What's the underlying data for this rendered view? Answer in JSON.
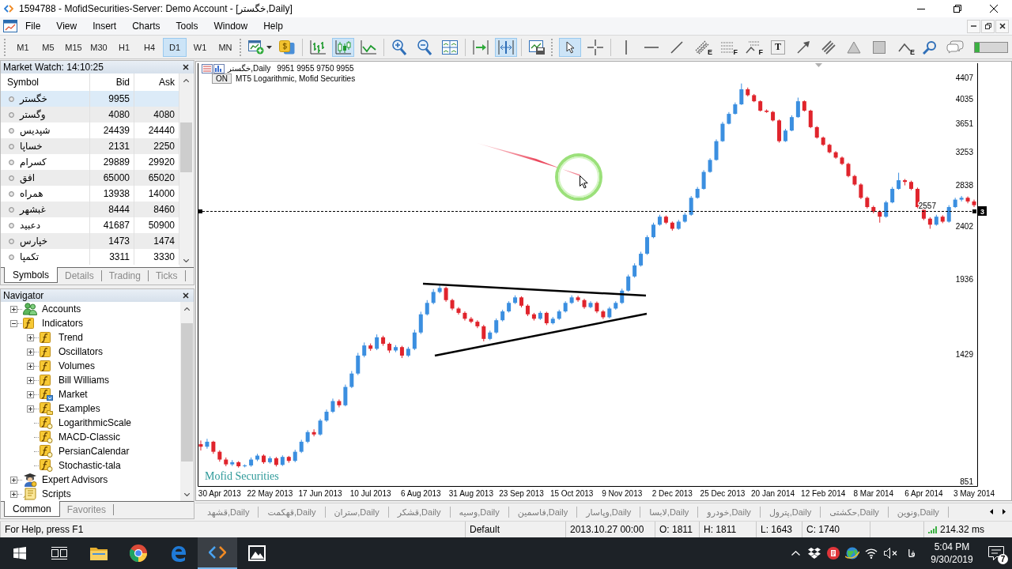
{
  "window": {
    "title": "1594788 - MofidSecurities-Server: Demo Account - [خگستر,Daily]"
  },
  "menu": [
    "File",
    "View",
    "Insert",
    "Charts",
    "Tools",
    "Window",
    "Help"
  ],
  "toolbar": {
    "timeframes": [
      {
        "label": "M1",
        "selected": false
      },
      {
        "label": "M5",
        "selected": false
      },
      {
        "label": "M15",
        "selected": false
      },
      {
        "label": "M30",
        "selected": false
      },
      {
        "label": "H1",
        "selected": false
      },
      {
        "label": "H4",
        "selected": false
      },
      {
        "label": "D1",
        "selected": true
      },
      {
        "label": "W1",
        "selected": false
      },
      {
        "label": "MN",
        "selected": false
      }
    ],
    "bands": [
      [
        [
          {
            "kind": "new-chart",
            "selected": false,
            "dropdown": true
          },
          {
            "kind": "trade",
            "selected": false
          }
        ],
        [
          {
            "kind": "bar-chart",
            "selected": false
          },
          {
            "kind": "candles",
            "selected": true
          },
          {
            "kind": "line-chart",
            "selected": false
          }
        ],
        [
          {
            "kind": "zoom-in",
            "selected": false
          },
          {
            "kind": "zoom-out",
            "selected": false
          },
          {
            "kind": "tile",
            "selected": false
          }
        ],
        [
          {
            "kind": "chart-shift",
            "selected": false
          },
          {
            "kind": "autoscroll",
            "selected": true
          }
        ],
        [
          {
            "kind": "templates",
            "selected": false
          }
        ]
      ],
      [
        [
          {
            "kind": "cursor",
            "selected": true
          },
          {
            "kind": "crosshair",
            "selected": false
          }
        ],
        [
          {
            "kind": "vline",
            "selected": false
          },
          {
            "kind": "hline",
            "selected": false
          },
          {
            "kind": "trendline",
            "selected": false
          },
          {
            "kind": "channel",
            "selected": false,
            "badge": "E"
          },
          {
            "kind": "fibo",
            "selected": false,
            "badge": "F"
          },
          {
            "kind": "fibo-fan",
            "selected": false,
            "badge": "F"
          },
          {
            "kind": "text",
            "selected": false,
            "badge": "T"
          },
          {
            "kind": "arrow",
            "selected": false
          },
          {
            "kind": "parallel",
            "selected": false
          },
          {
            "kind": "triangle",
            "selected": false
          },
          {
            "kind": "rectangle",
            "selected": false
          },
          {
            "kind": "polyline",
            "selected": false,
            "badge": "E"
          },
          {
            "kind": "search",
            "selected": false
          },
          {
            "kind": "chat",
            "selected": false
          }
        ]
      ]
    ],
    "meter": {
      "level": 0.15
    }
  },
  "market_watch": {
    "title": "Market Watch: 14:10:25",
    "columns": [
      "Symbol",
      "Bid",
      "Ask"
    ],
    "rows": [
      {
        "symbol": "خگستر",
        "bid": "9955",
        "selected": true
      },
      {
        "symbol": "وگستر",
        "bid": "4080",
        "ask": "4080",
        "selected": false
      },
      {
        "symbol": "شپدیس",
        "bid": "24439",
        "ask": "24440",
        "selected": false
      },
      {
        "symbol": "خساپا",
        "bid": "2131",
        "ask": "2250",
        "selected": false
      },
      {
        "symbol": "کسرام",
        "bid": "29889",
        "ask": "29920",
        "selected": false
      },
      {
        "symbol": "افق",
        "bid": "65000",
        "ask": "65020",
        "selected": false
      },
      {
        "symbol": "همراه",
        "bid": "13938",
        "ask": "14000",
        "selected": false
      },
      {
        "symbol": "غبشهر",
        "bid": "8444",
        "ask": "8460",
        "selected": false
      },
      {
        "symbol": "دعبید",
        "bid": "41687",
        "ask": "50900",
        "selected": false
      },
      {
        "symbol": "خپارس",
        "bid": "1473",
        "ask": "1474",
        "selected": false
      },
      {
        "symbol": "تکمپا",
        "bid": "3311",
        "ask": "3330",
        "selected": false
      }
    ],
    "tabs": [
      {
        "label": "Symbols",
        "selected": true
      },
      {
        "label": "Details",
        "selected": false
      },
      {
        "label": "Trading",
        "selected": false
      },
      {
        "label": "Ticks",
        "selected": false
      }
    ]
  },
  "navigator": {
    "title": "Navigator",
    "tree": [
      {
        "label": "Accounts",
        "kind": "accounts",
        "expanded": false
      },
      {
        "label": "Indicators",
        "kind": "indicator-folder",
        "expanded": true,
        "children": [
          {
            "label": "Trend",
            "kind": "indicator-folder",
            "expanded": false
          },
          {
            "label": "Oscillators",
            "kind": "indicator-folder",
            "expanded": false
          },
          {
            "label": "Volumes",
            "kind": "indicator-folder",
            "expanded": false
          },
          {
            "label": "Bill Williams",
            "kind": "indicator-folder",
            "expanded": false
          },
          {
            "label": "Market",
            "kind": "market-folder",
            "expanded": false
          },
          {
            "label": "Examples",
            "kind": "examples-folder",
            "expanded": false
          },
          {
            "label": "LogarithmicScale",
            "kind": "indicator"
          },
          {
            "label": "MACD-Classic",
            "kind": "indicator"
          },
          {
            "label": "PersianCalendar",
            "kind": "indicator"
          },
          {
            "label": "Stochastic-tala",
            "kind": "indicator"
          }
        ]
      },
      {
        "label": "Expert Advisors",
        "kind": "experts",
        "expanded": false
      },
      {
        "label": "Scripts",
        "kind": "scripts",
        "expanded": false
      }
    ],
    "tabs": [
      {
        "label": "Common",
        "selected": true
      },
      {
        "label": "Favorites",
        "selected": false
      }
    ]
  },
  "chart": {
    "symbol": "خگستر,Daily",
    "prices": "9951 9955 9750 9955",
    "indicator_toggle": "ON",
    "indicator": "MT5 Logarithmic, Mofid Securities",
    "brand_text": "Mofid Securities",
    "price_tag": "3",
    "chart_data": {
      "type": "candlestick",
      "log": true,
      "ylim": [
        835,
        4670
      ],
      "yticks": [
        851,
        1429,
        1936,
        2402,
        2838,
        3253,
        3651,
        4035,
        4407
      ],
      "categories": [
        null,
        null,
        null,
        "30 Apr 2013",
        null,
        null,
        null,
        null,
        null,
        null,
        null,
        "22 May 2013",
        null,
        null,
        null,
        null,
        null,
        null,
        null,
        "17 Jun 2013",
        null,
        null,
        null,
        null,
        null,
        null,
        null,
        "10 Jul 2013",
        null,
        null,
        null,
        null,
        null,
        null,
        null,
        "6 Aug 2013",
        null,
        null,
        null,
        null,
        null,
        null,
        null,
        "31 Aug 2013",
        null,
        null,
        null,
        null,
        null,
        null,
        null,
        "23 Sep 2013",
        null,
        null,
        null,
        null,
        null,
        null,
        null,
        "15 Oct 2013",
        null,
        null,
        null,
        null,
        null,
        null,
        null,
        "9 Nov 2013",
        null,
        null,
        null,
        null,
        null,
        null,
        null,
        "2 Dec 2013",
        null,
        null,
        null,
        null,
        null,
        null,
        null,
        "25 Dec 2013",
        null,
        null,
        null,
        null,
        null,
        null,
        null,
        "20 Jan 2014",
        null,
        null,
        null,
        null,
        null,
        null,
        null,
        "12 Feb 2014",
        null,
        null,
        null,
        null,
        null,
        null,
        null,
        "8 Mar 2014",
        null,
        null,
        null,
        null,
        null,
        null,
        null,
        "6 Apr 2014",
        null,
        null,
        null,
        null,
        null,
        null,
        null,
        "3 May 2014"
      ],
      "ohlc": [
        [
          990,
          1005,
          965,
          980
        ],
        [
          980,
          1012,
          972,
          1000
        ],
        [
          1000,
          1004,
          952,
          960
        ],
        [
          960,
          966,
          922,
          930
        ],
        [
          930,
          938,
          905,
          912
        ],
        [
          912,
          928,
          906,
          920
        ],
        [
          920,
          924,
          900,
          905
        ],
        [
          905,
          912,
          901,
          908
        ],
        [
          908,
          938,
          903,
          930
        ],
        [
          930,
          952,
          924,
          945
        ],
        [
          945,
          950,
          914,
          920
        ],
        [
          920,
          942,
          915,
          935
        ],
        [
          935,
          940,
          904,
          910
        ],
        [
          910,
          946,
          906,
          940
        ],
        [
          940,
          944,
          918,
          925
        ],
        [
          925,
          968,
          920,
          960
        ],
        [
          960,
          1008,
          955,
          1000
        ],
        [
          1000,
          1048,
          994,
          1040
        ],
        [
          1040,
          1052,
          1022,
          1030
        ],
        [
          1030,
          1098,
          1025,
          1090
        ],
        [
          1090,
          1140,
          1084,
          1130
        ],
        [
          1130,
          1192,
          1124,
          1180
        ],
        [
          1180,
          1188,
          1150,
          1160
        ],
        [
          1160,
          1262,
          1155,
          1250
        ],
        [
          1250,
          1334,
          1244,
          1320
        ],
        [
          1320,
          1436,
          1312,
          1420
        ],
        [
          1420,
          1498,
          1410,
          1480
        ],
        [
          1480,
          1492,
          1448,
          1460
        ],
        [
          1460,
          1548,
          1452,
          1530
        ],
        [
          1530,
          1540,
          1478,
          1490
        ],
        [
          1490,
          1498,
          1436,
          1450
        ],
        [
          1450,
          1482,
          1440,
          1470
        ],
        [
          1470,
          1478,
          1406,
          1420
        ],
        [
          1420,
          1472,
          1412,
          1460
        ],
        [
          1460,
          1578,
          1452,
          1560
        ],
        [
          1560,
          1698,
          1550,
          1680
        ],
        [
          1680,
          1780,
          1672,
          1760
        ],
        [
          1760,
          1862,
          1750,
          1840
        ],
        [
          1840,
          1895,
          1830,
          1870
        ],
        [
          1870,
          1880,
          1768,
          1780
        ],
        [
          1780,
          1790,
          1708,
          1720
        ],
        [
          1720,
          1730,
          1678,
          1690
        ],
        [
          1690,
          1700,
          1638,
          1650
        ],
        [
          1650,
          1662,
          1620,
          1630
        ],
        [
          1630,
          1640,
          1588,
          1600
        ],
        [
          1600,
          1610,
          1505,
          1520
        ],
        [
          1520,
          1572,
          1512,
          1560
        ],
        [
          1560,
          1652,
          1552,
          1640
        ],
        [
          1640,
          1712,
          1632,
          1700
        ],
        [
          1700,
          1772,
          1692,
          1760
        ],
        [
          1760,
          1815,
          1752,
          1800
        ],
        [
          1800,
          1808,
          1728,
          1740
        ],
        [
          1740,
          1750,
          1668,
          1680
        ],
        [
          1680,
          1690,
          1638,
          1650
        ],
        [
          1650,
          1702,
          1642,
          1690
        ],
        [
          1690,
          1698,
          1608,
          1620
        ],
        [
          1620,
          1662,
          1612,
          1650
        ],
        [
          1650,
          1712,
          1642,
          1700
        ],
        [
          1700,
          1772,
          1692,
          1760
        ],
        [
          1760,
          1815,
          1752,
          1800
        ],
        [
          1800,
          1812,
          1768,
          1780
        ],
        [
          1780,
          1790,
          1718,
          1730
        ],
        [
          1730,
          1772,
          1722,
          1760
        ],
        [
          1760,
          1770,
          1688,
          1700
        ],
        [
          1700,
          1710,
          1648,
          1660
        ],
        [
          1660,
          1732,
          1652,
          1720
        ],
        [
          1720,
          1772,
          1712,
          1760
        ],
        [
          1760,
          1865,
          1752,
          1850
        ],
        [
          1850,
          1975,
          1842,
          1960
        ],
        [
          1960,
          2068,
          1950,
          2050
        ],
        [
          2050,
          2168,
          2040,
          2150
        ],
        [
          2150,
          2318,
          2140,
          2300
        ],
        [
          2300,
          2440,
          2290,
          2420
        ],
        [
          2420,
          2520,
          2410,
          2500
        ],
        [
          2500,
          2512,
          2426,
          2440
        ],
        [
          2440,
          2452,
          2362,
          2380
        ],
        [
          2380,
          2468,
          2370,
          2450
        ],
        [
          2450,
          2540,
          2440,
          2520
        ],
        [
          2520,
          2720,
          2510,
          2700
        ],
        [
          2700,
          2822,
          2690,
          2800
        ],
        [
          2800,
          3022,
          2790,
          3000
        ],
        [
          3000,
          3172,
          2990,
          3150
        ],
        [
          3150,
          3425,
          3140,
          3400
        ],
        [
          3400,
          3678,
          3390,
          3650
        ],
        [
          3650,
          3828,
          3640,
          3800
        ],
        [
          3800,
          3980,
          3790,
          3950
        ],
        [
          3950,
          4300,
          3940,
          4200
        ],
        [
          4200,
          4230,
          4080,
          4100
        ],
        [
          4100,
          4120,
          3985,
          4000
        ],
        [
          4000,
          4015,
          3835,
          3850
        ],
        [
          3850,
          3870,
          3815,
          3830
        ],
        [
          3830,
          3845,
          3685,
          3700
        ],
        [
          3700,
          3715,
          3380,
          3400
        ],
        [
          3400,
          3575,
          3390,
          3550
        ],
        [
          3550,
          3778,
          3540,
          3750
        ],
        [
          3750,
          4060,
          3740,
          4000
        ],
        [
          4000,
          4015,
          3835,
          3850
        ],
        [
          3850,
          3865,
          3585,
          3600
        ],
        [
          3600,
          3615,
          3435,
          3450
        ],
        [
          3450,
          3465,
          3335,
          3350
        ],
        [
          3350,
          3365,
          3235,
          3250
        ],
        [
          3250,
          3265,
          3165,
          3180
        ],
        [
          3180,
          3195,
          3085,
          3100
        ],
        [
          3100,
          3115,
          2935,
          2950
        ],
        [
          2950,
          2965,
          2835,
          2850
        ],
        [
          2850,
          2865,
          2685,
          2700
        ],
        [
          2700,
          2715,
          2585,
          2600
        ],
        [
          2600,
          2615,
          2535,
          2550
        ],
        [
          2550,
          2565,
          2440,
          2500
        ],
        [
          2500,
          2668,
          2490,
          2650
        ],
        [
          2650,
          2822,
          2640,
          2800
        ],
        [
          2800,
          2990,
          2790,
          2900
        ],
        [
          2900,
          2915,
          2840,
          2880
        ],
        [
          2880,
          2895,
          2785,
          2800
        ],
        [
          2800,
          2815,
          2585,
          2600
        ],
        [
          2600,
          2615,
          2465,
          2480
        ],
        [
          2480,
          2495,
          2380,
          2420
        ],
        [
          2420,
          2520,
          2410,
          2500
        ],
        [
          2500,
          2515,
          2435,
          2450
        ],
        [
          2450,
          2620,
          2440,
          2600
        ],
        [
          2600,
          2700,
          2590,
          2680
        ],
        [
          2680,
          2720,
          2660,
          2700
        ],
        [
          2700,
          2715,
          2640,
          2660
        ],
        [
          2660,
          2680,
          2600,
          2620
        ]
      ],
      "ref_lines": [
        {
          "axis": "y",
          "value": 2557,
          "label": "2557",
          "line_style": "dashed"
        }
      ]
    }
  },
  "chart_tabs": [
    {
      "label": "قشهد,Daily",
      "selected": false
    },
    {
      "label": "قهکمت,Daily",
      "selected": false
    },
    {
      "label": "ستران,Daily",
      "selected": false
    },
    {
      "label": "قشکر,Daily",
      "selected": false
    },
    {
      "label": "وسیه,Daily",
      "selected": false
    },
    {
      "label": "فاسمین,Daily",
      "selected": false
    },
    {
      "label": "وپاسار,Daily",
      "selected": false
    },
    {
      "label": "لابسا,Daily",
      "selected": false
    },
    {
      "label": "خودرو,Daily",
      "selected": false
    },
    {
      "label": "پترول,Daily",
      "selected": false
    },
    {
      "label": "حکشتی,Daily",
      "selected": false
    },
    {
      "label": "ونوین,Daily",
      "selected": false
    }
  ],
  "status_bar": {
    "help": "For Help, press F1",
    "profile": "Default",
    "time": "2013.10.27 00:00",
    "open": "O: 1811",
    "high": "H: 1811",
    "low": "L: 1643",
    "close": "C: 1740",
    "ping": "214.32 ms"
  },
  "taskbar": {
    "items": [
      {
        "kind": "start",
        "active": false
      },
      {
        "kind": "task-view",
        "active": false
      },
      {
        "kind": "folder",
        "active": false
      },
      {
        "kind": "chrome",
        "active": false
      },
      {
        "kind": "edge",
        "active": false
      },
      {
        "kind": "code",
        "active": true
      },
      {
        "kind": "photos",
        "active": false
      }
    ],
    "tray": [
      {
        "kind": "chevron"
      },
      {
        "kind": "dropbox"
      },
      {
        "kind": "red-app"
      },
      {
        "kind": "globe"
      },
      {
        "kind": "wifi"
      },
      {
        "kind": "speaker-muted"
      }
    ],
    "language": "فا",
    "time": "5:04 PM",
    "date": "9/30/2019",
    "notification_count": "7"
  }
}
